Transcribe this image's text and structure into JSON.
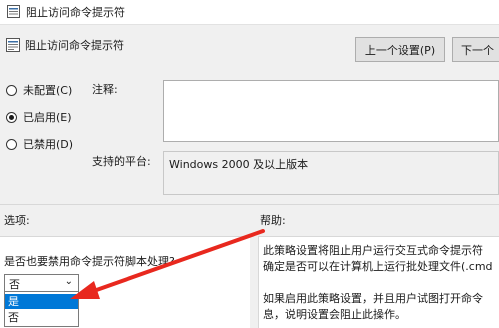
{
  "window": {
    "title": "阻止访问命令提示符"
  },
  "header": {
    "policy_name": "阻止访问命令提示符",
    "prev_button": "上一个设置(P)",
    "next_button": "下一个"
  },
  "state_options": [
    {
      "label": "未配置(C)",
      "selected": false
    },
    {
      "label": "已启用(E)",
      "selected": true
    },
    {
      "label": "已禁用(D)",
      "selected": false
    }
  ],
  "comment": {
    "label": "注释:",
    "value": ""
  },
  "platform": {
    "label": "支持的平台:",
    "value": "Windows 2000 及以上版本"
  },
  "options": {
    "heading": "选项:",
    "question": "是否也要禁用命令提示符脚本处理?",
    "select_value": "否",
    "dropdown_items": [
      "是",
      "否"
    ],
    "highlighted": "是"
  },
  "help": {
    "heading": "帮助:",
    "lines": [
      "此策略设置将阻止用户运行交互式命令提示符",
      "确定是否可以在计算机上运行批处理文件(.cmd",
      "",
      "如果启用此策略设置，并且用户试图打开命令",
      "息，说明设置会阻止此操作。"
    ]
  },
  "colors": {
    "selection": "#0078d7",
    "annotation_arrow": "#e8281e"
  }
}
